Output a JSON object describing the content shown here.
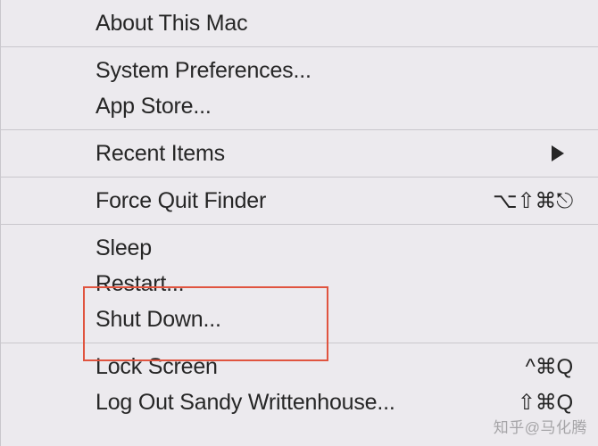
{
  "menu": {
    "groups": [
      {
        "items": [
          {
            "id": "about",
            "label": "About This Mac",
            "shortcut": "",
            "submenu": false
          }
        ]
      },
      {
        "items": [
          {
            "id": "sysprefs",
            "label": "System Preferences...",
            "shortcut": "",
            "submenu": false
          },
          {
            "id": "appstore",
            "label": "App Store...",
            "shortcut": "",
            "submenu": false
          }
        ]
      },
      {
        "items": [
          {
            "id": "recent",
            "label": "Recent Items",
            "shortcut": "",
            "submenu": true
          }
        ]
      },
      {
        "items": [
          {
            "id": "forcequit",
            "label": "Force Quit Finder",
            "shortcut": "⌥⇧⌘⎋",
            "submenu": false
          }
        ]
      },
      {
        "items": [
          {
            "id": "sleep",
            "label": "Sleep",
            "shortcut": "",
            "submenu": false
          },
          {
            "id": "restart",
            "label": "Restart...",
            "shortcut": "",
            "submenu": false
          },
          {
            "id": "shutdown",
            "label": "Shut Down...",
            "shortcut": "",
            "submenu": false
          }
        ]
      },
      {
        "items": [
          {
            "id": "lock",
            "label": "Lock Screen",
            "shortcut": "^⌘Q",
            "submenu": false
          },
          {
            "id": "logout",
            "label": "Log Out Sandy Writtenhouse...",
            "shortcut": "⇧⌘Q",
            "submenu": false
          }
        ]
      }
    ]
  },
  "watermark": "知乎@马化腾"
}
